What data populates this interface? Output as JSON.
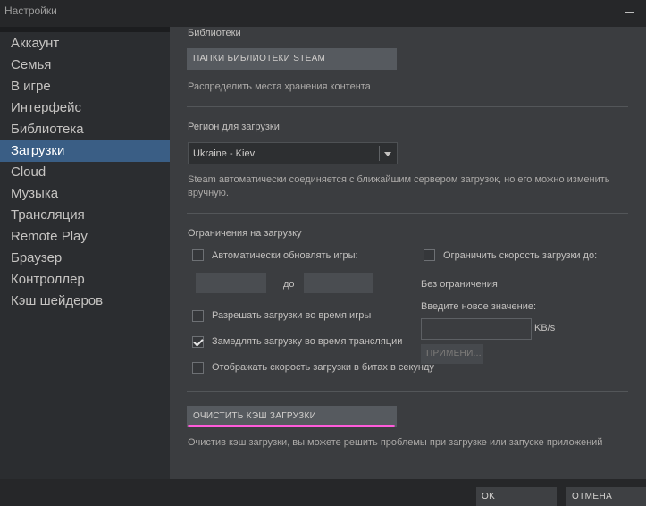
{
  "window": {
    "title": "Настройки"
  },
  "sidebar": {
    "items": [
      {
        "label": "Аккаунт"
      },
      {
        "label": "Семья"
      },
      {
        "label": "В игре"
      },
      {
        "label": "Интерфейс"
      },
      {
        "label": "Библиотека"
      },
      {
        "label": "Загрузки"
      },
      {
        "label": "Cloud"
      },
      {
        "label": "Музыка"
      },
      {
        "label": "Трансляция"
      },
      {
        "label": "Remote Play"
      },
      {
        "label": "Браузер"
      },
      {
        "label": "Контроллер"
      },
      {
        "label": "Кэш шейдеров"
      }
    ],
    "active_item": "Загрузки"
  },
  "libraries": {
    "heading": "Библиотеки",
    "button_label": "ПАПКИ БИБЛИОТЕКИ STEAM",
    "description": "Распределить места хранения контента"
  },
  "region": {
    "heading": "Регион для загрузки",
    "selected": "Ukraine - Kiev",
    "description": "Steam автоматически соединяется с ближайшим сервером загрузок, но его можно изменить вручную."
  },
  "restrictions": {
    "heading": "Ограничения на загрузку",
    "auto_update": {
      "label": "Автоматически обновлять игры:",
      "checked": false
    },
    "time_to_label": "до",
    "limit_speed": {
      "label": "Ограничить скорость загрузки до:",
      "checked": false
    },
    "no_limit_text": "Без ограничения",
    "new_value_label": "Введите новое значение:",
    "unit": "KB/s",
    "apply_label": "ПРИМЕНИ...",
    "allow_during_game": {
      "label": "Разрешать загрузки во время игры",
      "checked": false
    },
    "throttle_streaming": {
      "label": "Замедлять загрузку во время трансляции",
      "checked": true
    },
    "show_bits": {
      "label": "Отображать скорость загрузки в битах в секунду",
      "checked": false
    }
  },
  "cache": {
    "button_label": "ОЧИСТИТЬ КЭШ ЗАГРУЗКИ",
    "description": "Очистив кэш загрузки, вы можете решить проблемы при загрузке или запуске приложений"
  },
  "footer": {
    "ok_label": "OK",
    "cancel_label": "ОТМЕНА"
  },
  "colors": {
    "accent": "#3a5e85",
    "highlight": "#ff5bdb"
  }
}
